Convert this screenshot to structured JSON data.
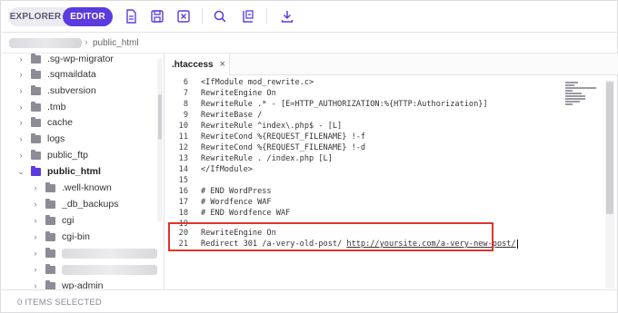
{
  "toolbar": {
    "explorer_label": "EXPLORER",
    "editor_label": "EDITOR",
    "icons": [
      "new-file-icon",
      "save-icon",
      "close-file-icon",
      "search-icon",
      "replace-icon",
      "download-icon"
    ],
    "accent_color": "#5b3be0"
  },
  "breadcrumb": {
    "current": "public_html"
  },
  "tree": {
    "items": [
      {
        "label": ".sg-wp-migrator",
        "expanded": false
      },
      {
        "label": ".sqmaildata",
        "expanded": false
      },
      {
        "label": ".subversion",
        "expanded": false
      },
      {
        "label": ".tmb",
        "expanded": false
      },
      {
        "label": "cache",
        "expanded": false
      },
      {
        "label": "logs",
        "expanded": false
      },
      {
        "label": "public_ftp",
        "expanded": false
      },
      {
        "label": "public_html",
        "expanded": true,
        "active": true
      },
      {
        "label": ".well-known",
        "expanded": false
      },
      {
        "label": "_db_backups",
        "expanded": false
      },
      {
        "label": "cgi",
        "expanded": false
      },
      {
        "label": "cgi-bin",
        "expanded": false
      },
      {
        "label": "",
        "expanded": false,
        "redacted": true
      },
      {
        "label": "",
        "expanded": false,
        "redacted": true
      },
      {
        "label": "wp-admin",
        "expanded": false
      }
    ]
  },
  "editor": {
    "tab": {
      "name": ".htaccess",
      "close": "×"
    },
    "lines": [
      {
        "n": "6",
        "text": "<IfModule mod_rewrite.c>"
      },
      {
        "n": "7",
        "text": "RewriteEngine On"
      },
      {
        "n": "8",
        "text": "RewriteRule .* - [E=HTTP_AUTHORIZATION:%{HTTP:Authorization}]"
      },
      {
        "n": "9",
        "text": "RewriteBase /"
      },
      {
        "n": "10",
        "text": "RewriteRule ^index\\.php$ - [L]"
      },
      {
        "n": "11",
        "text": "RewriteCond %{REQUEST_FILENAME} !-f"
      },
      {
        "n": "12",
        "text": "RewriteCond %{REQUEST_FILENAME} !-d"
      },
      {
        "n": "13",
        "text": "RewriteRule . /index.php [L]"
      },
      {
        "n": "14",
        "text": "</IfModule>"
      },
      {
        "n": "15",
        "text": ""
      },
      {
        "n": "16",
        "text": "# END WordPress"
      },
      {
        "n": "17",
        "text": "# Wordfence WAF"
      },
      {
        "n": "18",
        "text": "# END Wordfence WAF"
      },
      {
        "n": "19",
        "text": ""
      },
      {
        "n": "20",
        "text": "RewriteEngine On"
      },
      {
        "n": "21",
        "text": "Redirect 301 /a-very-old-post/ ",
        "url": "http://yoursite.com/a-very-new-post/"
      }
    ],
    "highlight_color": "#e0342c"
  },
  "footer": {
    "status": "0 ITEMS SELECTED"
  }
}
